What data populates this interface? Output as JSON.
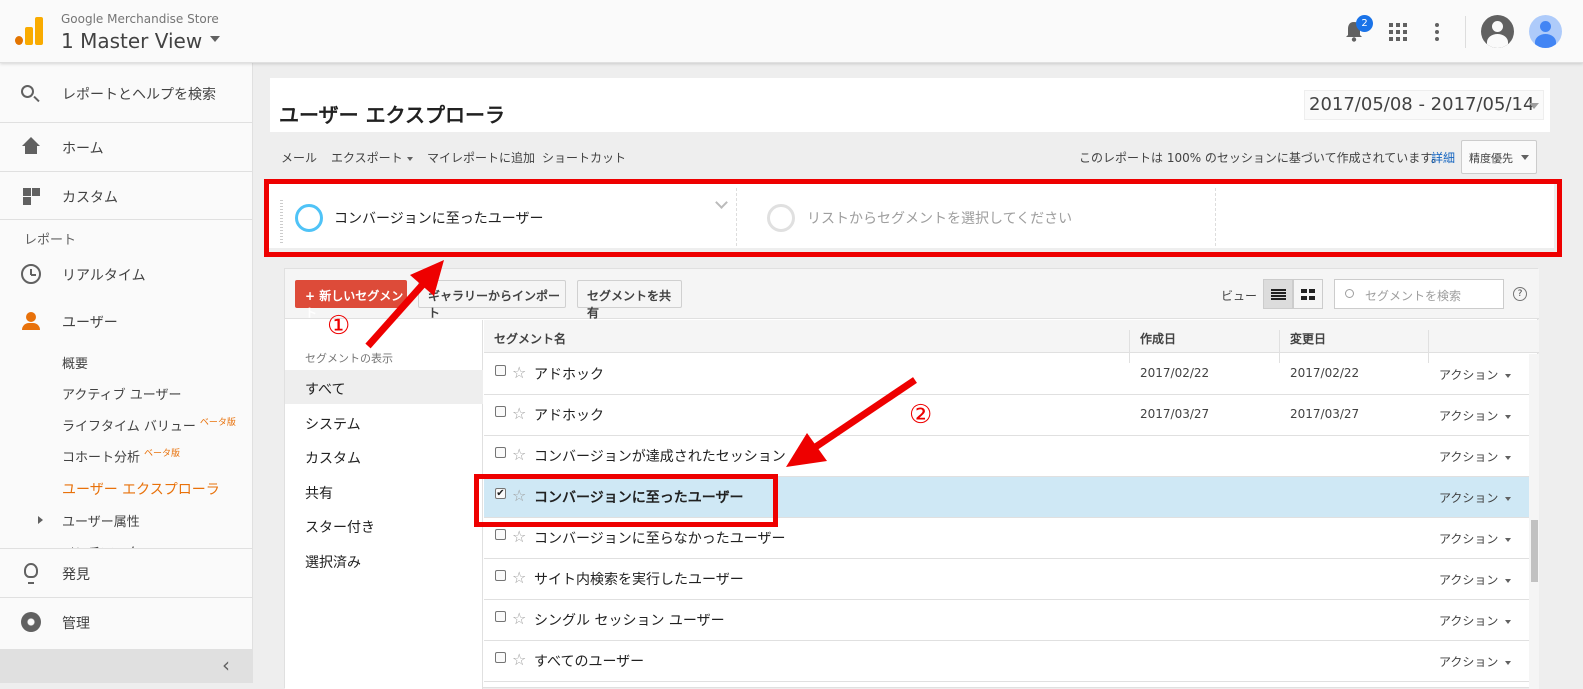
{
  "header": {
    "account": "Google Merchandise Store",
    "view": "1 Master View",
    "notification_count": "2"
  },
  "sidebar": {
    "search": "レポートとヘルプを検索",
    "home": "ホーム",
    "custom": "カスタム",
    "reports_section": "レポート",
    "realtime": "リアルタイム",
    "users": "ユーザー",
    "sub": {
      "overview": "概要",
      "active_users": "アクティブ ユーザー",
      "lifetime_value": "ライフタイム バリュー",
      "cohort": "コホート分析",
      "beta": "ベータ版",
      "explorer": "ユーザー エクスプローラ",
      "attributes": "ユーザー属性",
      "partial": "ベンチマーク"
    },
    "discover": "発見",
    "admin": "管理"
  },
  "main": {
    "title": "ユーザー エクスプローラ",
    "date_range": "2017/05/08 - 2017/05/14",
    "toolbar": {
      "mail": "メール",
      "export": "エクスポート",
      "add_dashboard": "マイレポートに追加",
      "shortcut": "ショートカット",
      "session_note": "このレポートは 100% のセッションに基づいて作成されています。",
      "detail": "詳細",
      "precision": "精度優先"
    },
    "segments": {
      "active": "コンバージョンに至ったユーザー",
      "placeholder": "リストからセグメントを選択してください"
    }
  },
  "panel": {
    "new_segment": "+ 新しいセグメント",
    "import_gallery": "ギャラリーからインポート",
    "share_segment": "セグメントを共有",
    "view_label": "ビュー",
    "search_placeholder": "セグメントを検索",
    "help": "?",
    "categories_header": "セグメントの表示",
    "categories": [
      "すべて",
      "システム",
      "カスタム",
      "共有",
      "スター付き",
      "選択済み"
    ],
    "columns": [
      "セグメント名",
      "作成日",
      "変更日"
    ],
    "action_label": "アクション",
    "rows": [
      {
        "name": "アドホック",
        "created": "2017/02/22",
        "modified": "2017/02/22",
        "checked": false
      },
      {
        "name": "アドホック",
        "created": "2017/03/27",
        "modified": "2017/03/27",
        "checked": false
      },
      {
        "name": "コンバージョンが達成されたセッション",
        "created": "",
        "modified": "",
        "checked": false
      },
      {
        "name": "コンバージョンに至ったユーザー",
        "created": "",
        "modified": "",
        "checked": true
      },
      {
        "name": "コンバージョンに至らなかったユーザー",
        "created": "",
        "modified": "",
        "checked": false
      },
      {
        "name": "サイト内検索を実行したユーザー",
        "created": "",
        "modified": "",
        "checked": false
      },
      {
        "name": "シングル セッション ユーザー",
        "created": "",
        "modified": "",
        "checked": false
      },
      {
        "name": "すべてのユーザー",
        "created": "",
        "modified": "",
        "checked": false
      }
    ]
  },
  "annotations": {
    "one": "①",
    "two": "②",
    "color": "#ee0000"
  }
}
